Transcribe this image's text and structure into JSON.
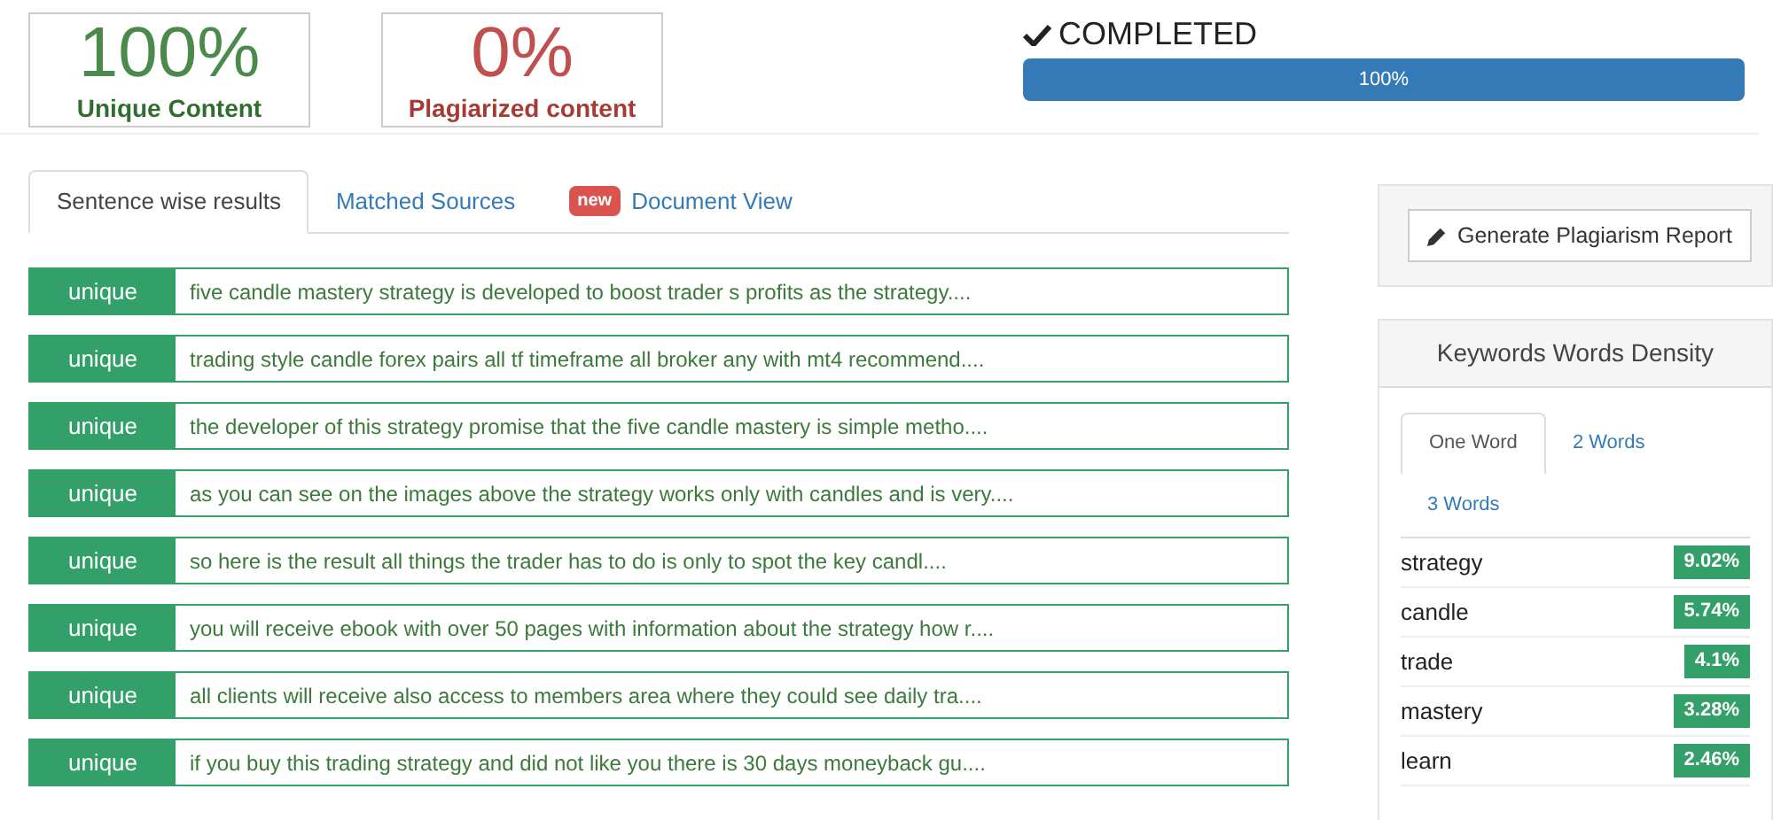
{
  "stats": [
    {
      "value": "100%",
      "label": "Unique Content",
      "kind": "unique"
    },
    {
      "value": "0%",
      "label": "Plagiarized content",
      "kind": "plagiarized"
    }
  ],
  "status": {
    "title": "COMPLETED",
    "level": 1,
    "reading": "100%"
  },
  "tabs": [
    {
      "label": "Sentence wise results",
      "selected": true
    },
    {
      "label": "Matched Sources",
      "selected": false
    },
    {
      "label": "Document View",
      "badge": "new",
      "selected": false
    }
  ],
  "results": [
    {
      "status": "unique",
      "text": "five candle mastery strategy is developed to boost trader s profits as the strategy...."
    },
    {
      "status": "unique",
      "text": "trading style candle forex pairs all tf timeframe all broker any with mt4 recommend...."
    },
    {
      "status": "unique",
      "text": "the developer of this strategy promise that the five candle mastery is simple metho...."
    },
    {
      "status": "unique",
      "text": "as you can see on the images above the strategy works only with candles and is very...."
    },
    {
      "status": "unique",
      "text": "so here is the result all things the trader has to do is only to spot the key candl...."
    },
    {
      "status": "unique",
      "text": "you will receive ebook with over 50 pages with information about the strategy how r...."
    },
    {
      "status": "unique",
      "text": "all clients will receive also access to members area where they could see daily tra...."
    },
    {
      "status": "unique",
      "text": "if you buy this trading strategy and did not like you there is 30 days moneyback gu...."
    }
  ],
  "report_button": "Generate Plagiarism Report",
  "density": {
    "title": "Keywords Words Density",
    "tabs": [
      {
        "label": "One Word",
        "selected": true
      },
      {
        "label": "2 Words",
        "selected": false
      },
      {
        "label": "3 Words",
        "selected": false
      }
    ],
    "keywords": [
      {
        "word": "strategy",
        "percent": "9.02%"
      },
      {
        "word": "candle",
        "percent": "5.74%"
      },
      {
        "word": "trade",
        "percent": "4.1%"
      },
      {
        "word": "mastery",
        "percent": "3.28%"
      },
      {
        "word": "learn",
        "percent": "2.46%"
      }
    ]
  }
}
